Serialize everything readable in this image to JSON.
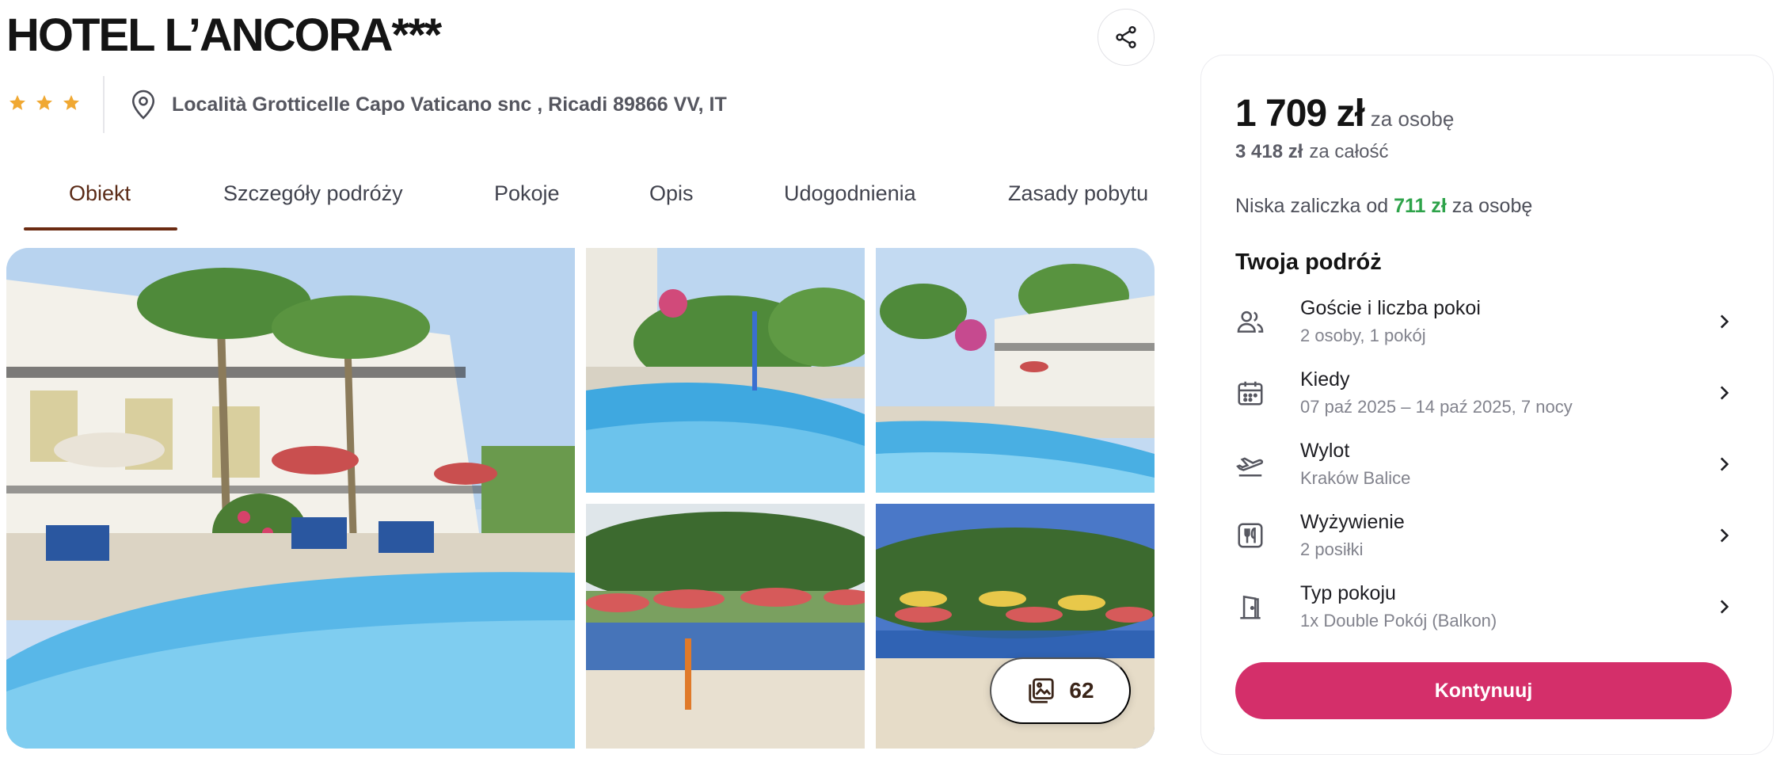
{
  "hotel": {
    "title": "HOTEL L’ANCORA***",
    "stars": 3,
    "address": "Località Grotticelle Capo Vaticano snc , Ricadi 89866 VV, IT"
  },
  "icons": {
    "share": "share-icon",
    "location": "map-pin-icon",
    "gallery": "gallery-icon",
    "guests": "users-icon",
    "dates": "calendar-icon",
    "flight": "plane-takeoff-icon",
    "board": "cutlery-icon",
    "room": "door-icon",
    "chevron": "chevron-right-icon"
  },
  "tabs": [
    {
      "label": "Obiekt",
      "active": true
    },
    {
      "label": "Szczegóły podróży",
      "active": false
    },
    {
      "label": "Pokoje",
      "active": false
    },
    {
      "label": "Opis",
      "active": false
    },
    {
      "label": "Udogodnienia",
      "active": false
    },
    {
      "label": "Zasady pobytu",
      "active": false
    }
  ],
  "gallery": {
    "photo_count": "62"
  },
  "booking": {
    "price": "1 709 zł",
    "price_unit": "za osobę",
    "total": "3 418 zł",
    "total_unit": "za całość",
    "deposit_prefix": "Niska zaliczka od",
    "deposit_value": "711 zł",
    "deposit_suffix": "za osobę",
    "trip_title": "Twoja podróż",
    "items": [
      {
        "label": "Goście i liczba pokoi",
        "value": "2 osoby, 1 pokój"
      },
      {
        "label": "Kiedy",
        "value": "07 paź 2025 – 14 paź 2025, 7 nocy"
      },
      {
        "label": "Wylot",
        "value": "Kraków Balice"
      },
      {
        "label": "Wyżywienie",
        "value": "2 posiłki"
      },
      {
        "label": "Typ pokoju",
        "value": "1x Double Pokój (Balkon)"
      }
    ],
    "continue_label": "Kontynuuj"
  },
  "colors": {
    "accent": "#d42f6a",
    "tab_active": "#6b2b12",
    "deposit_green": "#2ea34a",
    "star": "#f0a832"
  }
}
